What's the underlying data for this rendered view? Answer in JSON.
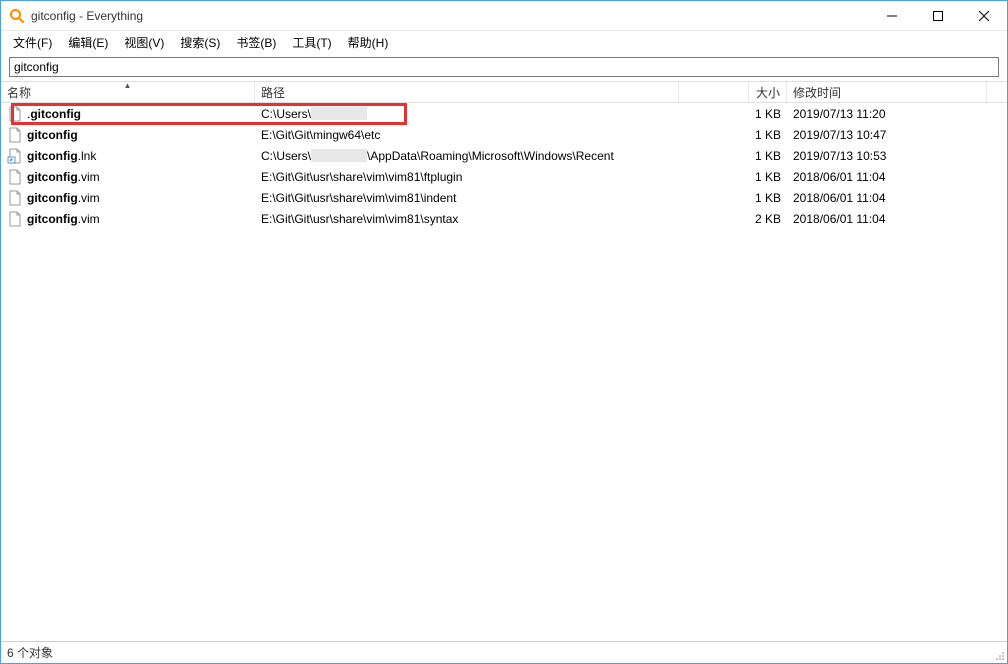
{
  "window": {
    "title": "gitconfig - Everything"
  },
  "menu": {
    "file": "文件(F)",
    "edit": "编辑(E)",
    "view": "视图(V)",
    "search": "搜索(S)",
    "bookmarks": "书签(B)",
    "tools": "工具(T)",
    "help": "帮助(H)"
  },
  "search": {
    "value": "gitconfig"
  },
  "columns": {
    "name": "名称",
    "path": "路径",
    "size": "大小",
    "date": "修改时间"
  },
  "rows": [
    {
      "icon": "file",
      "name_prefix": ".",
      "name_bold": "gitconfig",
      "name_suffix": "",
      "path_prefix": "C:\\Users\\",
      "path_redacted": true,
      "path_suffix": "",
      "size": "1 KB",
      "date": "2019/07/13 11:20"
    },
    {
      "icon": "file",
      "name_prefix": "",
      "name_bold": "gitconfig",
      "name_suffix": "",
      "path_prefix": "E:\\Git\\Git\\mingw64\\etc",
      "path_redacted": false,
      "path_suffix": "",
      "size": "1 KB",
      "date": "2019/07/13 10:47"
    },
    {
      "icon": "lnk",
      "name_prefix": "",
      "name_bold": "gitconfig",
      "name_suffix": ".lnk",
      "path_prefix": "C:\\Users\\",
      "path_redacted": true,
      "path_suffix": "\\AppData\\Roaming\\Microsoft\\Windows\\Recent",
      "size": "1 KB",
      "date": "2019/07/13 10:53"
    },
    {
      "icon": "file",
      "name_prefix": "",
      "name_bold": "gitconfig",
      "name_suffix": ".vim",
      "path_prefix": "E:\\Git\\Git\\usr\\share\\vim\\vim81\\ftplugin",
      "path_redacted": false,
      "path_suffix": "",
      "size": "1 KB",
      "date": "2018/06/01 11:04"
    },
    {
      "icon": "file",
      "name_prefix": "",
      "name_bold": "gitconfig",
      "name_suffix": ".vim",
      "path_prefix": "E:\\Git\\Git\\usr\\share\\vim\\vim81\\indent",
      "path_redacted": false,
      "path_suffix": "",
      "size": "1 KB",
      "date": "2018/06/01 11:04"
    },
    {
      "icon": "file",
      "name_prefix": "",
      "name_bold": "gitconfig",
      "name_suffix": ".vim",
      "path_prefix": "E:\\Git\\Git\\usr\\share\\vim\\vim81\\syntax",
      "path_redacted": false,
      "path_suffix": "",
      "size": "2 KB",
      "date": "2018/06/01 11:04"
    }
  ],
  "status": {
    "text": "6 个对象"
  }
}
